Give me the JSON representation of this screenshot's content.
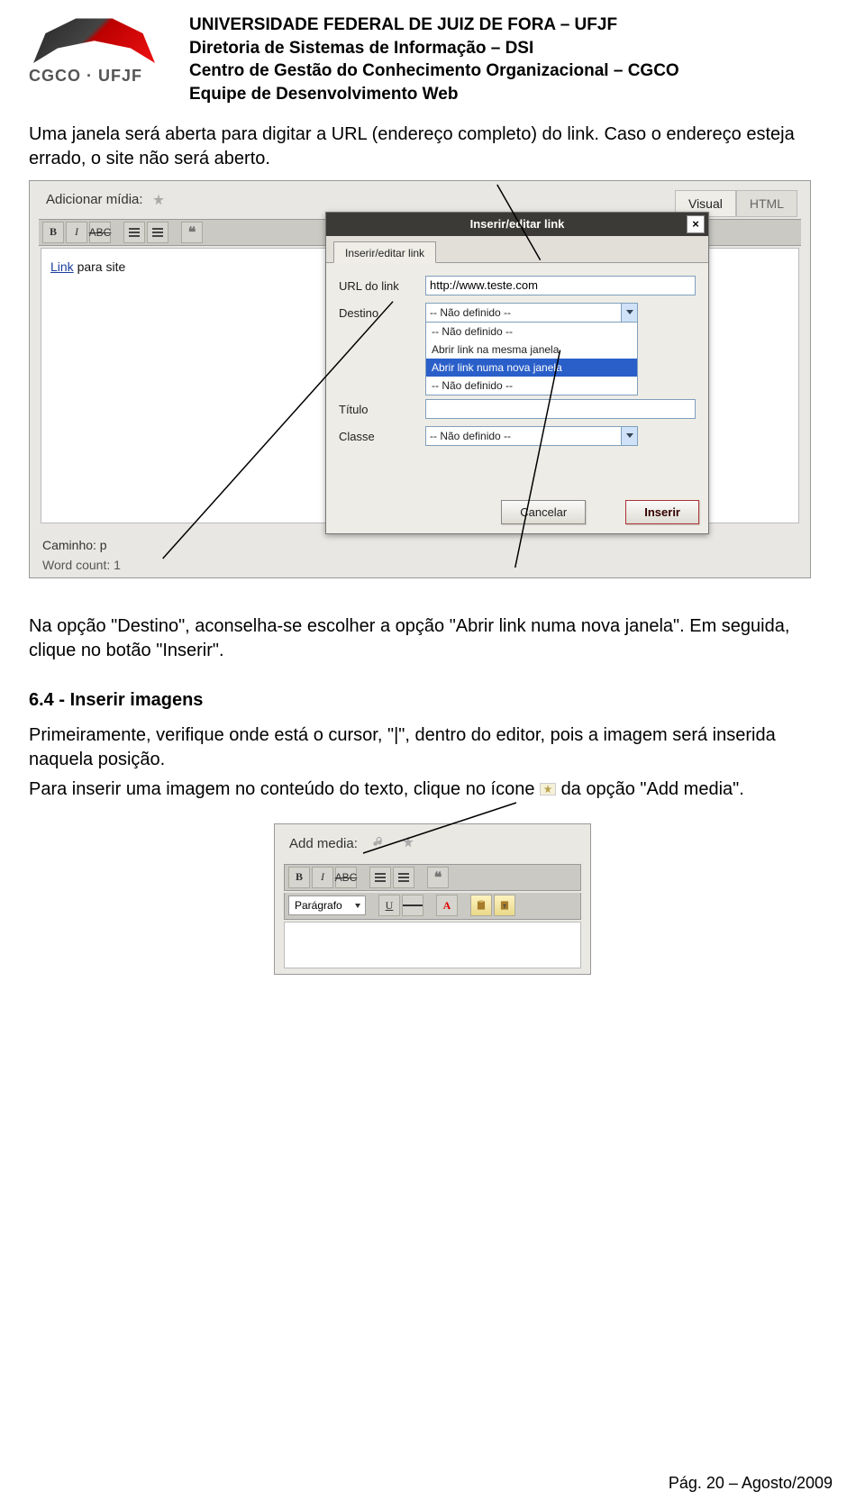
{
  "header": {
    "logo_text": "CGCO · UFJF",
    "line1": "UNIVERSIDADE FEDERAL DE JUIZ DE FORA – UFJF",
    "line2": "Diretoria de Sistemas de Informação – DSI",
    "line3": "Centro de Gestão do Conhecimento Organizacional – CGCO",
    "line4": "Equipe de Desenvolvimento Web"
  },
  "body": {
    "p1": "Uma janela será aberta para digitar a URL (endereço completo) do link. Caso o endereço esteja errado, o site não será aberto.",
    "p2": "Na opção \"Destino\", aconselha-se escolher a opção \"Abrir link numa nova janela\". Em seguida, clique no botão \"Inserir\".",
    "section_title": "6.4 - Inserir imagens",
    "p3": "Primeiramente, verifique onde está o cursor, \"|\", dentro do editor, pois a imagem será inserida naquela posição.",
    "p4a": "Para inserir uma imagem no conteúdo do texto, clique no ícone",
    "p4b": "da opção \"Add media\"."
  },
  "shot1": {
    "adicionar": "Adicionar mídia:",
    "tabs": {
      "visual": "Visual",
      "html": "HTML"
    },
    "editor_link_text_underlined": "Link",
    "editor_link_text_rest": " para site",
    "caminho": "Caminho: p",
    "wordcount": "Word count: 1",
    "modal": {
      "title": "Inserir/editar link",
      "tab": "Inserir/editar link",
      "url_label": "URL do link",
      "url_value": "http://www.teste.com",
      "destino_label": "Destino",
      "destino_value": "-- Não definido --",
      "titulo_label": "Título",
      "classe_label": "Classe",
      "classe_value": "-- Não definido --",
      "options": [
        "-- Não definido --",
        "Abrir link na mesma janela",
        "Abrir link numa nova janela",
        "-- Não definido --"
      ],
      "selected_index": 2,
      "cancel": "Cancelar",
      "insert": "Inserir"
    }
  },
  "shot2": {
    "addmedia": "Add media:",
    "paragrafo": "Parágrafo"
  },
  "footer": {
    "text": "Pág. 20 – Agosto/2009"
  }
}
